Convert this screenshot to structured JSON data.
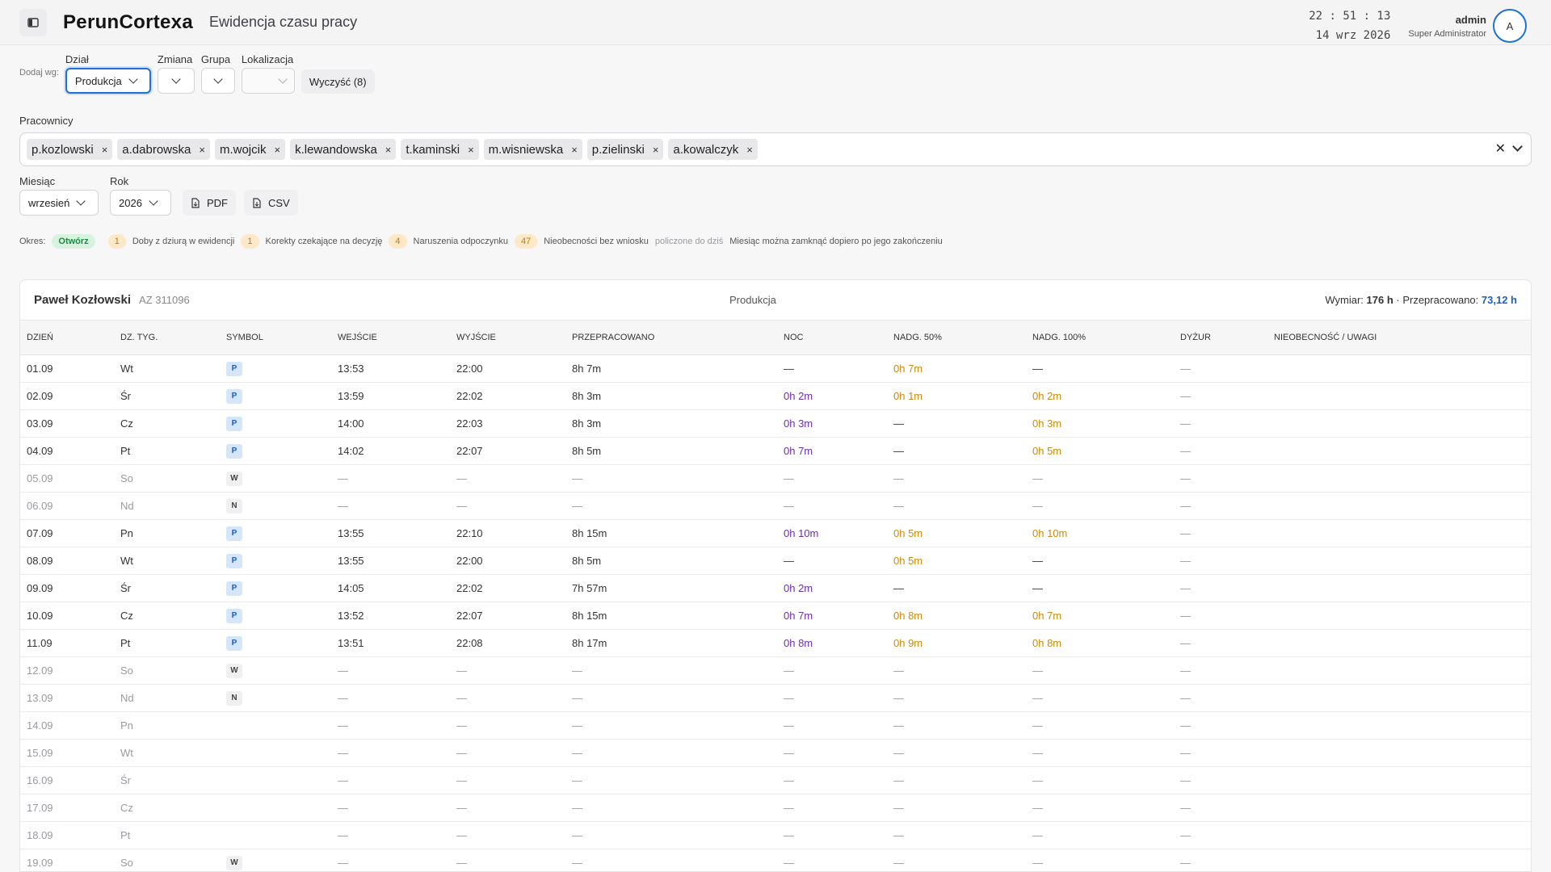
{
  "app": {
    "name": "PerunCortexa",
    "page_title": "Ewidencja czasu pracy"
  },
  "clock": {
    "time": "22 : 51 : 13",
    "date": "14 wrz 2026"
  },
  "user": {
    "name": "admin",
    "role": "Super Administrator",
    "initial": "A"
  },
  "filters": {
    "add_by_label": "Dodaj wg:",
    "dept_label": "Dział",
    "dept_value": "Produkcja",
    "shift_label": "Zmiana",
    "group_label": "Grupa",
    "location_label": "Lokalizacja",
    "clear_label": "Wyczyść (8)"
  },
  "employees": {
    "label": "Pracownicy",
    "chips": [
      "p.kozlowski",
      "a.dabrowska",
      "m.wojcik",
      "k.lewandowska",
      "t.kaminski",
      "m.wisniewska",
      "p.zielinski",
      "a.kowalczyk"
    ]
  },
  "period": {
    "month_label": "Miesiąc",
    "month_value": "wrzesień",
    "year_label": "Rok",
    "year_value": "2026",
    "pdf_label": "PDF",
    "csv_label": "CSV"
  },
  "status": {
    "okres_label": "Okres:",
    "open_badge": "Otwórz",
    "holes_count": "1",
    "holes_label": "Doby z dziurą w ewidencji",
    "corrections_count": "1",
    "corrections_label": "Korekty czekające na decyzję",
    "rest_count": "4",
    "rest_label": "Naruszenia odpoczynku",
    "absence_count": "47",
    "absence_label": "Nieobecności bez wniosku",
    "counted_note": "policzone do dziś",
    "close_note": "Miesiąc można zamknąć dopiero po jego zakończeniu"
  },
  "card": {
    "employee_name": "Paweł Kozłowski",
    "employee_id": "AZ 311096",
    "department": "Produkcja",
    "norm_label": "Wymiar:",
    "norm_value": "176 h",
    "worked_label": "· Przepracowano:",
    "worked_value": "73,12 h"
  },
  "columns": [
    "DZIEŃ",
    "DZ. TYG.",
    "SYMBOL",
    "WEJŚCIE",
    "WYJŚCIE",
    "PRZEPRACOWANO",
    "NOC",
    "NADG. 50%",
    "NADG. 100%",
    "DYŻUR",
    "NIEOBECNOŚĆ / UWAGI"
  ],
  "rows": [
    {
      "day": "01.09",
      "dow": "Wt",
      "symbol": "P",
      "in": "13:53",
      "out": "22:00",
      "worked": "8h 7m",
      "night": "—",
      "ot50": "0h 7m",
      "ot100": "—",
      "duty": "—",
      "note": "",
      "off": false
    },
    {
      "day": "02.09",
      "dow": "Śr",
      "symbol": "P",
      "in": "13:59",
      "out": "22:02",
      "worked": "8h 3m",
      "night": "0h 2m",
      "ot50": "0h 1m",
      "ot100": "0h 2m",
      "duty": "—",
      "note": "",
      "off": false
    },
    {
      "day": "03.09",
      "dow": "Cz",
      "symbol": "P",
      "in": "14:00",
      "out": "22:03",
      "worked": "8h 3m",
      "night": "0h 3m",
      "ot50": "—",
      "ot100": "0h 3m",
      "duty": "—",
      "note": "",
      "off": false
    },
    {
      "day": "04.09",
      "dow": "Pt",
      "symbol": "P",
      "in": "14:02",
      "out": "22:07",
      "worked": "8h 5m",
      "night": "0h 7m",
      "ot50": "—",
      "ot100": "0h 5m",
      "duty": "—",
      "note": "",
      "off": false
    },
    {
      "day": "05.09",
      "dow": "So",
      "symbol": "W",
      "in": "—",
      "out": "—",
      "worked": "—",
      "night": "—",
      "ot50": "—",
      "ot100": "—",
      "duty": "—",
      "note": "",
      "off": true
    },
    {
      "day": "06.09",
      "dow": "Nd",
      "symbol": "N",
      "in": "—",
      "out": "—",
      "worked": "—",
      "night": "—",
      "ot50": "—",
      "ot100": "—",
      "duty": "—",
      "note": "",
      "off": true
    },
    {
      "day": "07.09",
      "dow": "Pn",
      "symbol": "P",
      "in": "13:55",
      "out": "22:10",
      "worked": "8h 15m",
      "night": "0h 10m",
      "ot50": "0h 5m",
      "ot100": "0h 10m",
      "duty": "—",
      "note": "",
      "off": false
    },
    {
      "day": "08.09",
      "dow": "Wt",
      "symbol": "P",
      "in": "13:55",
      "out": "22:00",
      "worked": "8h 5m",
      "night": "—",
      "ot50": "0h 5m",
      "ot100": "—",
      "duty": "—",
      "note": "",
      "off": false
    },
    {
      "day": "09.09",
      "dow": "Śr",
      "symbol": "P",
      "in": "14:05",
      "out": "22:02",
      "worked": "7h 57m",
      "night": "0h 2m",
      "ot50": "—",
      "ot100": "—",
      "duty": "—",
      "note": "",
      "off": false
    },
    {
      "day": "10.09",
      "dow": "Cz",
      "symbol": "P",
      "in": "13:52",
      "out": "22:07",
      "worked": "8h 15m",
      "night": "0h 7m",
      "ot50": "0h 8m",
      "ot100": "0h 7m",
      "duty": "—",
      "note": "",
      "off": false
    },
    {
      "day": "11.09",
      "dow": "Pt",
      "symbol": "P",
      "in": "13:51",
      "out": "22:08",
      "worked": "8h 17m",
      "night": "0h 8m",
      "ot50": "0h 9m",
      "ot100": "0h 8m",
      "duty": "—",
      "note": "",
      "off": false
    },
    {
      "day": "12.09",
      "dow": "So",
      "symbol": "W",
      "in": "—",
      "out": "—",
      "worked": "—",
      "night": "—",
      "ot50": "—",
      "ot100": "—",
      "duty": "—",
      "note": "",
      "off": true
    },
    {
      "day": "13.09",
      "dow": "Nd",
      "symbol": "N",
      "in": "—",
      "out": "—",
      "worked": "—",
      "night": "—",
      "ot50": "—",
      "ot100": "—",
      "duty": "—",
      "note": "",
      "off": true
    },
    {
      "day": "14.09",
      "dow": "Pn",
      "symbol": "",
      "in": "—",
      "out": "—",
      "worked": "—",
      "night": "—",
      "ot50": "—",
      "ot100": "—",
      "duty": "—",
      "note": "",
      "off": true
    },
    {
      "day": "15.09",
      "dow": "Wt",
      "symbol": "",
      "in": "—",
      "out": "—",
      "worked": "—",
      "night": "—",
      "ot50": "—",
      "ot100": "—",
      "duty": "—",
      "note": "",
      "off": true
    },
    {
      "day": "16.09",
      "dow": "Śr",
      "symbol": "",
      "in": "—",
      "out": "—",
      "worked": "—",
      "night": "—",
      "ot50": "—",
      "ot100": "—",
      "duty": "—",
      "note": "",
      "off": true
    },
    {
      "day": "17.09",
      "dow": "Cz",
      "symbol": "",
      "in": "—",
      "out": "—",
      "worked": "—",
      "night": "—",
      "ot50": "—",
      "ot100": "—",
      "duty": "—",
      "note": "",
      "off": true
    },
    {
      "day": "18.09",
      "dow": "Pt",
      "symbol": "",
      "in": "—",
      "out": "—",
      "worked": "—",
      "night": "—",
      "ot50": "—",
      "ot100": "—",
      "duty": "—",
      "note": "",
      "off": true
    },
    {
      "day": "19.09",
      "dow": "So",
      "symbol": "W",
      "in": "—",
      "out": "—",
      "worked": "—",
      "night": "—",
      "ot50": "—",
      "ot100": "—",
      "duty": "—",
      "note": "",
      "off": true
    }
  ],
  "colors": {
    "accent": "#1e6fd6",
    "night": "#6b2fa8",
    "overtime": "#c98a12",
    "open_badge": "#1a8a43"
  }
}
